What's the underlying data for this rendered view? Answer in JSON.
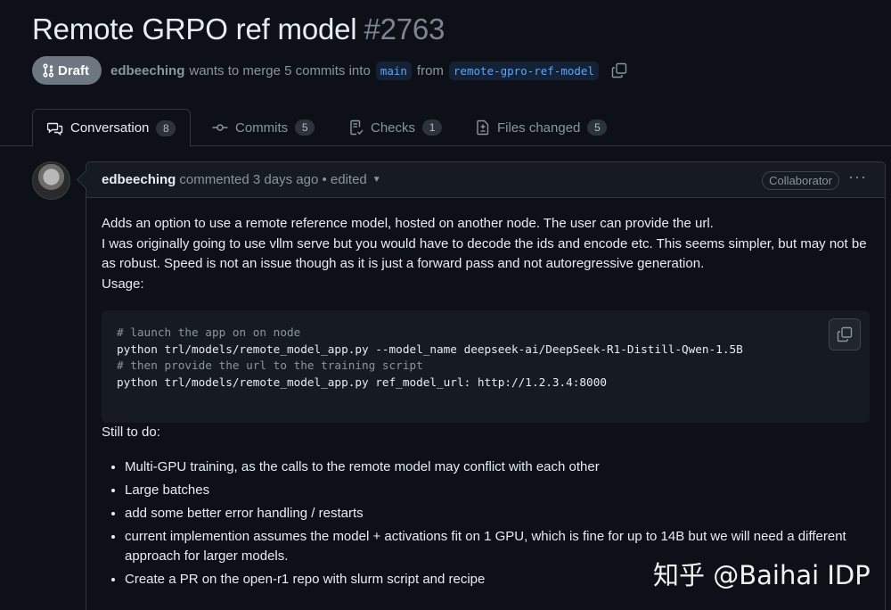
{
  "pr": {
    "title": "Remote GRPO ref model",
    "number": "#2763",
    "state": "Draft",
    "author": "edbeeching",
    "merge_text": "wants to merge 5 commits into",
    "base_branch": "main",
    "from_text": "from",
    "head_branch": "remote-gpro-ref-model"
  },
  "tabs": [
    {
      "label": "Conversation",
      "count": "8",
      "icon": "comment-discussion-icon"
    },
    {
      "label": "Commits",
      "count": "5",
      "icon": "git-commit-icon"
    },
    {
      "label": "Checks",
      "count": "1",
      "icon": "checklist-icon"
    },
    {
      "label": "Files changed",
      "count": "5",
      "icon": "file-diff-icon"
    }
  ],
  "comment": {
    "author": "edbeeching",
    "action": "commented 3 days ago",
    "edited": "• edited",
    "role": "Collaborator",
    "menu": "···",
    "paragraphs": [
      "Adds an option to use a remote reference model, hosted on another node. The user can provide the url.",
      "I was originally going to use vllm serve but you would have to decode the ids and encode etc. This seems simpler, but may not be as robust. Speed is not an issue though as it is just a forward pass and not autoregressive generation.",
      "Usage:"
    ],
    "code": [
      "# launch the app on on node",
      "python trl/models/remote_model_app.py --model_name deepseek-ai/DeepSeek-R1-Distill-Qwen-1.5B",
      "",
      "# then provide the url to the training script",
      "python trl/models/remote_model_app.py ref_model_url: http://1.2.3.4:8000"
    ],
    "todo_title": "Still to do:",
    "todo": [
      "Multi-GPU training, as the calls to the remote model may conflict with each other",
      "Large batches",
      "add some better error handling / restarts",
      "current implemention assumes the model + activations fit on 1 GPU, which is fine for up to 14B but we will need a different approach for larger models.",
      "Create a PR on the open-r1 repo with slurm script and recipe"
    ]
  },
  "watermark": "知乎 @Baihai IDP",
  "colors": {
    "background": "#0d1117",
    "border": "#30363d",
    "accent": "#58a6ff",
    "draft_badge": "#6e7681"
  }
}
